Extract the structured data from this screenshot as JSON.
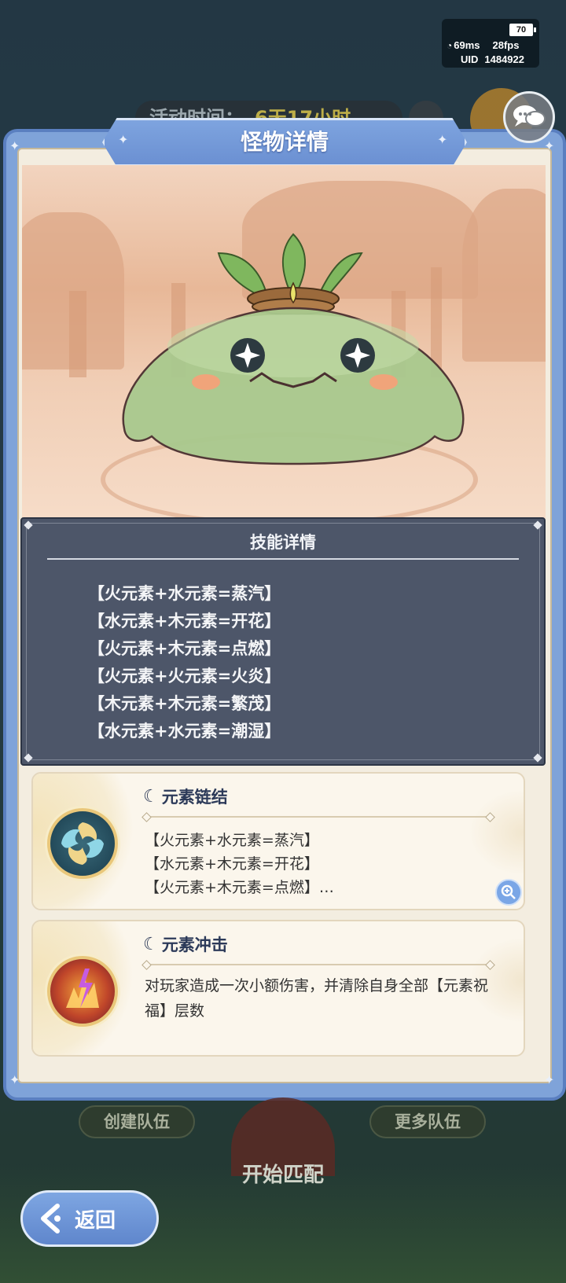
{
  "status": {
    "battery": "70",
    "ping": "69ms",
    "fps": "28fps",
    "uid_label": "UID",
    "uid_value": "1484922"
  },
  "background": {
    "activity_label": "活动时间：",
    "activity_time": "6天17小时",
    "create_team": "创建队伍",
    "more_teams": "更多队伍",
    "start_match": "开始匹配"
  },
  "dialog": {
    "title": "怪物详情"
  },
  "skill_details": {
    "title": "技能详情",
    "items": [
      "【火元素+水元素=蒸汽】",
      "【水元素+木元素=开花】",
      "【火元素+木元素=点燃】",
      "【火元素+火元素=火炎】",
      "【木元素+木元素=繁茂】",
      "【水元素+水元素=潮湿】"
    ]
  },
  "abilities": [
    {
      "title": "元素链结",
      "lines": [
        "【火元素+水元素=蒸汽】",
        "【水元素+木元素=开花】",
        "【火元素+木元素=点燃】…"
      ]
    },
    {
      "title": "元素冲击",
      "text": "对玩家造成一次小额伤害，并清除自身全部【元素祝福】层数"
    }
  ],
  "back_button": "返回",
  "colors": {
    "dialog_blue": "#7fa3d9",
    "panel_dark": "#404a60",
    "parchment": "#f3ede0",
    "slime_green": "#a9c98e"
  }
}
